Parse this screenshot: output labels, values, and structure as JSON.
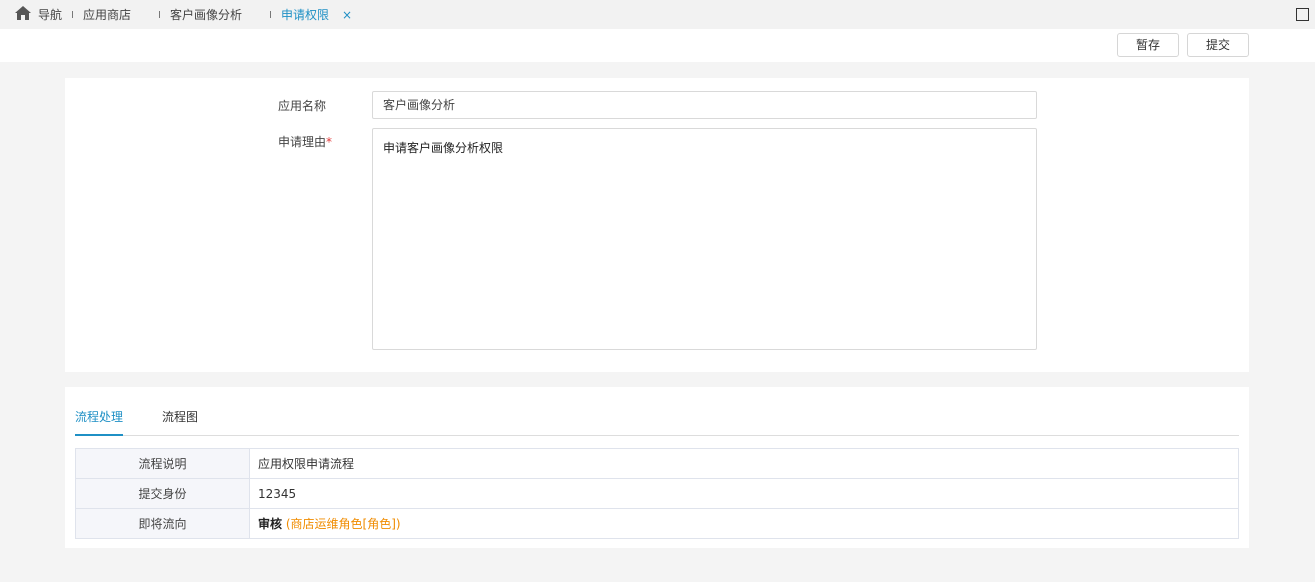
{
  "tabs": {
    "items": [
      {
        "label": "导航"
      },
      {
        "label": "应用商店"
      },
      {
        "label": "客户画像分析"
      },
      {
        "label": "申请权限"
      }
    ],
    "close_symbol": "×"
  },
  "toolbar": {
    "save_label": "暂存",
    "submit_label": "提交"
  },
  "form": {
    "app_name_label": "应用名称",
    "app_name_value": "客户画像分析",
    "reason_label": "申请理由",
    "required_mark": "*",
    "reason_value": "申请客户画像分析权限"
  },
  "process": {
    "tabs": [
      {
        "label": "流程处理",
        "active": true
      },
      {
        "label": "流程图",
        "active": false
      }
    ],
    "rows": [
      {
        "key": "流程说明",
        "value": "应用权限申请流程"
      },
      {
        "key": "提交身份",
        "value": "12345"
      },
      {
        "key": "即将流向",
        "value_bold": "审核",
        "value_note": "(商店运维角色[角色])"
      }
    ]
  },
  "colors": {
    "accent": "#1f90c5",
    "required": "#e03b3b",
    "note": "#f08c00"
  },
  "icons": {
    "home": "home-icon",
    "maximize": "maximize-icon",
    "close": "close-icon"
  }
}
